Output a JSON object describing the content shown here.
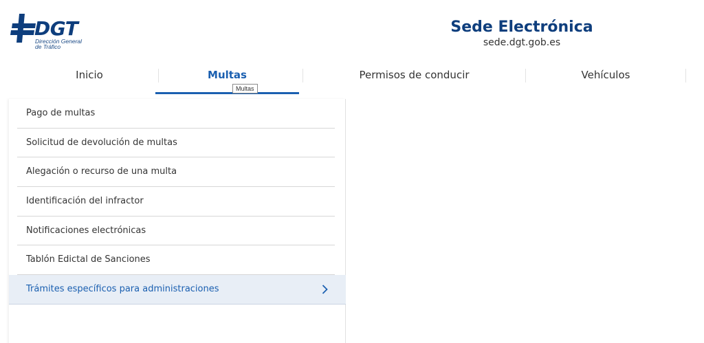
{
  "header": {
    "logo": {
      "brand": "DGT",
      "subtitle_line1": "Dirección General",
      "subtitle_line2": "de Tráfico"
    },
    "site_title": "Sede Electrónica",
    "site_url": "sede.dgt.gob.es"
  },
  "nav": {
    "items": [
      {
        "label": "Inicio"
      },
      {
        "label": "Multas"
      },
      {
        "label": "Permisos de conducir"
      },
      {
        "label": "Vehículos"
      }
    ],
    "active_tooltip": "Multas"
  },
  "menu": {
    "items": [
      {
        "label": "Pago de multas"
      },
      {
        "label": "Solicitud de devolución de multas"
      },
      {
        "label": "Alegación o recurso de una multa"
      },
      {
        "label": "Identificación del infractor"
      },
      {
        "label": "Notificaciones electrónicas"
      },
      {
        "label": "Tablón Edictal de Sanciones"
      },
      {
        "label": "Trámites específicos para administraciones",
        "icon": "chevron-right-icon"
      }
    ]
  },
  "colors": {
    "brand_blue": "#0e3e7d",
    "accent_blue": "#1a5fb0",
    "highlight_bg": "#e8eef6"
  }
}
